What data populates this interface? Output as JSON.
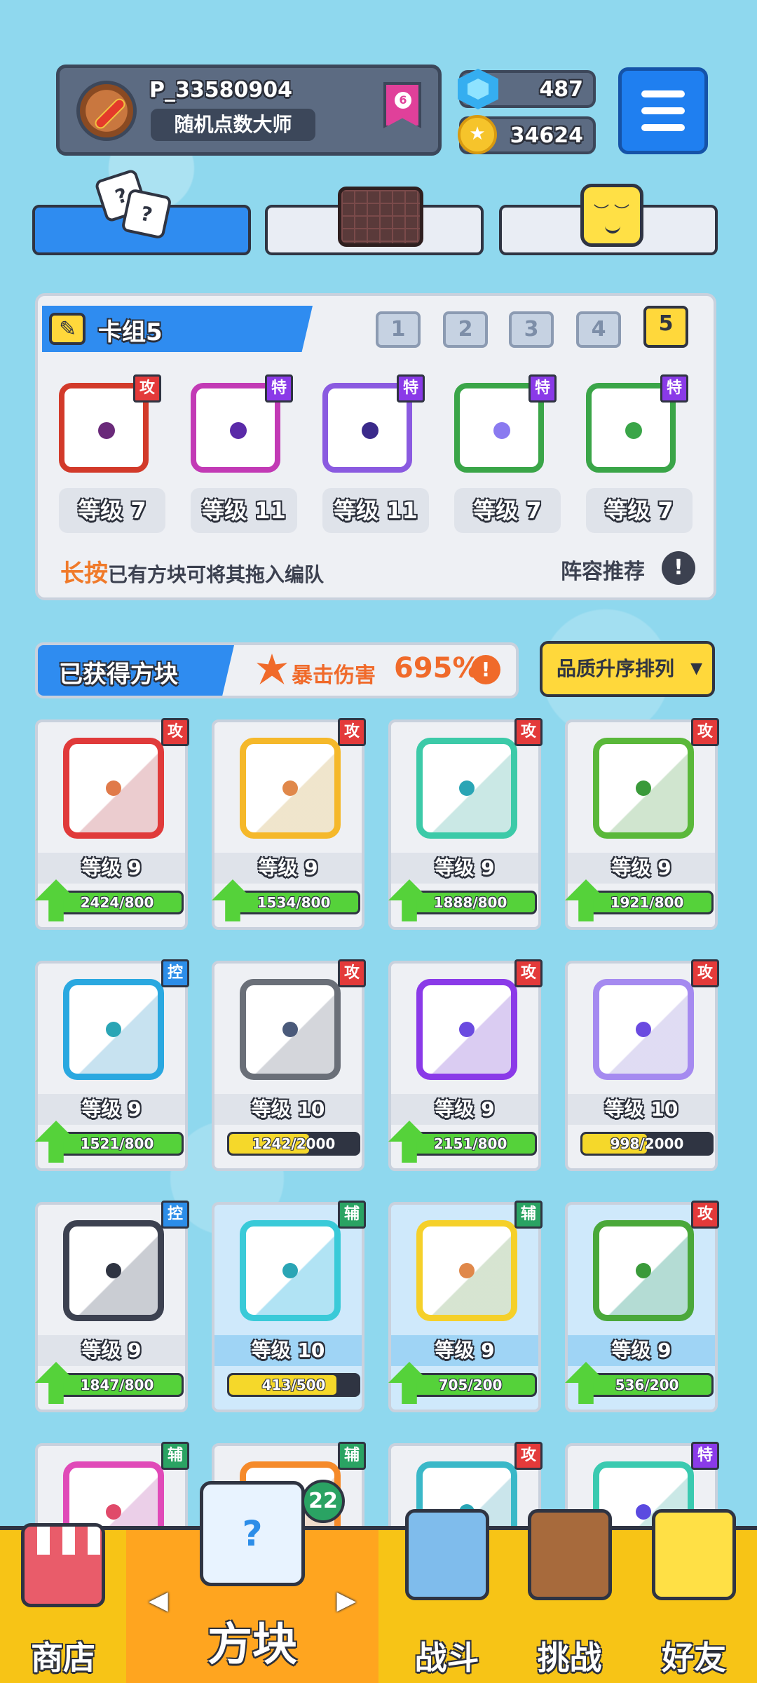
{
  "player": {
    "name": "P_33580904",
    "title": "随机点数大师",
    "rank": "6"
  },
  "currency": {
    "gems": "487",
    "coins": "34624"
  },
  "deck": {
    "title": "卡组5",
    "numbers": [
      "1",
      "2",
      "3",
      "4",
      "5"
    ],
    "active": "5",
    "slots": [
      {
        "tag": "攻",
        "type": "atk",
        "level": "等级 7",
        "color": "#d23a2a",
        "dot": "#6a2a7a"
      },
      {
        "tag": "特",
        "type": "spe",
        "level": "等级 11",
        "color": "#c23ab5",
        "dot": "#5a2aa8"
      },
      {
        "tag": "特",
        "type": "spe",
        "level": "等级 11",
        "color": "#8a5ae0",
        "dot": "#3a2a8a"
      },
      {
        "tag": "特",
        "type": "spe",
        "level": "等级 7",
        "color": "#3aa548",
        "dot": "#8a7af0"
      },
      {
        "tag": "特",
        "type": "spe",
        "level": "等级 7",
        "color": "#3aa548",
        "dot": "#3aa548"
      }
    ],
    "hint_key": "长按",
    "hint_text": "已有方块可将其拖入编队",
    "recommend": "阵容推荐"
  },
  "obtained": {
    "title": "已获得方块",
    "crit_label": "暴击伤害",
    "crit_value": "695%",
    "sort_label": "品质升序排列"
  },
  "blocks": [
    {
      "tag": "攻",
      "type": "atk",
      "level": "等级 9",
      "progress": "2424/800",
      "ratio": 1.0,
      "upgradable": true,
      "color": "#e03a3a",
      "dot": "#e07a4a",
      "hl": false
    },
    {
      "tag": "攻",
      "type": "atk",
      "level": "等级 9",
      "progress": "1534/800",
      "ratio": 1.0,
      "upgradable": true,
      "color": "#f5b82a",
      "dot": "#e0884a",
      "hl": false
    },
    {
      "tag": "攻",
      "type": "atk",
      "level": "等级 9",
      "progress": "1888/800",
      "ratio": 1.0,
      "upgradable": true,
      "color": "#3ccaa8",
      "dot": "#2aa5b5",
      "hl": false
    },
    {
      "tag": "攻",
      "type": "atk",
      "level": "等级 9",
      "progress": "1921/800",
      "ratio": 1.0,
      "upgradable": true,
      "color": "#5ab83a",
      "dot": "#3a9a3a",
      "hl": false
    },
    {
      "tag": "控",
      "type": "ctl",
      "level": "等级 9",
      "progress": "1521/800",
      "ratio": 1.0,
      "upgradable": true,
      "color": "#2aa8e0",
      "dot": "#2aa5b5",
      "hl": false
    },
    {
      "tag": "攻",
      "type": "atk",
      "level": "等级 10",
      "progress": "1242/2000",
      "ratio": 0.62,
      "upgradable": false,
      "color": "#6a6f78",
      "dot": "#4a5a7a",
      "hl": false
    },
    {
      "tag": "攻",
      "type": "atk",
      "level": "等级 9",
      "progress": "2151/800",
      "ratio": 1.0,
      "upgradable": true,
      "color": "#8a3ae8",
      "dot": "#6a4ae0",
      "hl": false
    },
    {
      "tag": "攻",
      "type": "atk",
      "level": "等级 10",
      "progress": "998/2000",
      "ratio": 0.5,
      "upgradable": false,
      "color": "#a58af0",
      "dot": "#6a4ae0",
      "hl": false
    },
    {
      "tag": "控",
      "type": "ctl",
      "level": "等级 9",
      "progress": "1847/800",
      "ratio": 1.0,
      "upgradable": true,
      "color": "#3c4150",
      "dot": "#2f3442",
      "hl": false
    },
    {
      "tag": "辅",
      "type": "sup",
      "level": "等级 10",
      "progress": "413/500",
      "ratio": 0.83,
      "upgradable": false,
      "color": "#3acad8",
      "dot": "#2aa5b5",
      "hl": true
    },
    {
      "tag": "辅",
      "type": "sup",
      "level": "等级 9",
      "progress": "705/200",
      "ratio": 1.0,
      "upgradable": true,
      "color": "#f5d02a",
      "dot": "#e0884a",
      "hl": true
    },
    {
      "tag": "攻",
      "type": "atk",
      "level": "等级 9",
      "progress": "536/200",
      "ratio": 1.0,
      "upgradable": true,
      "color": "#4aa83a",
      "dot": "#3a9a3a",
      "hl": true
    },
    {
      "tag": "辅",
      "type": "sup",
      "level": "",
      "progress": "",
      "ratio": 0,
      "upgradable": false,
      "color": "#e04ab8",
      "dot": "#e04a6a",
      "hl": false
    },
    {
      "tag": "辅",
      "type": "sup",
      "level": "",
      "progress": "",
      "ratio": 0,
      "upgradable": false,
      "color": "#f58a2a",
      "dot": "#e0884a",
      "hl": false
    },
    {
      "tag": "攻",
      "type": "atk",
      "level": "",
      "progress": "",
      "ratio": 0,
      "upgradable": false,
      "color": "#3ab8c8",
      "dot": "#2aa5b5",
      "hl": false
    },
    {
      "tag": "特",
      "type": "spe",
      "level": "",
      "progress": "",
      "ratio": 0,
      "upgradable": false,
      "color": "#3acab0",
      "dot": "#5a4ae0",
      "hl": false
    }
  ],
  "nav": {
    "shop": "商店",
    "blocks": "方块",
    "battle": "战斗",
    "challenge": "挑战",
    "friends": "好友",
    "blocks_badge": "22"
  },
  "colors": {
    "bar_full": "#55d23a",
    "bar_partial": "#f5d82a",
    "accent_blue": "#2f8cf0",
    "nav_yellow": "#f7c416"
  }
}
